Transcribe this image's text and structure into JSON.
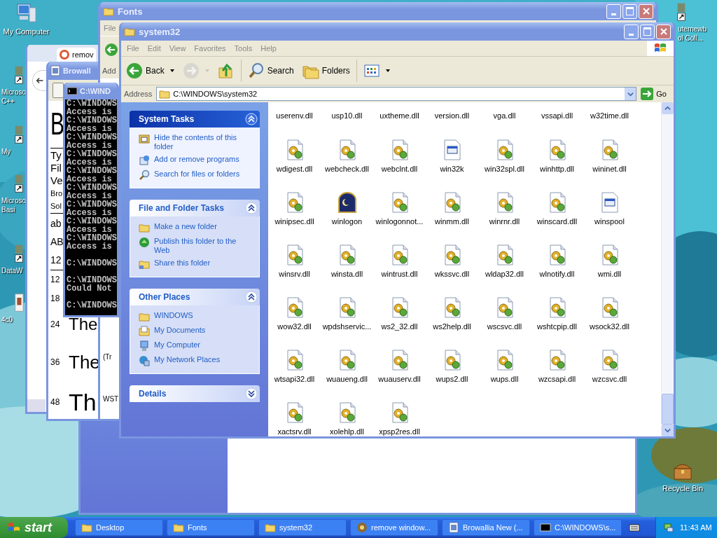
{
  "desktop_icons": [
    {
      "kind": "computer",
      "label_lines": [
        "My Computer"
      ]
    },
    {
      "kind": "shortcut",
      "label_lines": [
        "Microso",
        "C++"
      ]
    },
    {
      "kind": "shortcut",
      "label_lines": [
        "My"
      ]
    },
    {
      "kind": "shortcut",
      "label_lines": [
        "Microso",
        "Basi"
      ]
    },
    {
      "kind": "shortcut",
      "label_lines": [
        "DataW"
      ]
    },
    {
      "kind": "document",
      "label_lines": [
        "4c0"
      ]
    },
    {
      "kind": "shortcut",
      "label_lines": [
        "uternewb",
        "ol Coll..."
      ]
    },
    {
      "kind": "recycle",
      "label_lines": [
        "Recycle Bin"
      ]
    }
  ],
  "browser_window": {
    "tab_title": "remov"
  },
  "font_viewer": {
    "title": "Browall",
    "sample_big": "B",
    "info_lines": [
      "Ty",
      "Fil",
      "Ve",
      "Bro",
      "Sol"
    ],
    "charset_lines": [
      "ab",
      "AB",
      "12"
    ],
    "size_rows": [
      {
        "size": "12"
      },
      {
        "size": "18"
      },
      {
        "size": "24",
        "sample": "The"
      },
      {
        "size": "36",
        "sample": "The"
      },
      {
        "size": "48",
        "sample": "Th"
      }
    ]
  },
  "fonts_window": {
    "title": "Fonts",
    "menu_first": "File",
    "address_label": "Add",
    "content_texts": [
      "(Tr",
      "WST"
    ]
  },
  "console": {
    "title": "C:\\WIND",
    "blocks": [
      [
        "C:\\WINDOWS",
        "Access is",
        "C:\\WINDOWS",
        "Access is",
        "C:\\WINDOWS",
        "Access is",
        "C:\\WINDOWS",
        "Access is",
        "C:\\WINDOWS",
        "Access is",
        "C:\\WINDOWS",
        "Access is",
        "C:\\WINDOWS",
        "Access is",
        "C:\\WINDOWS",
        "Access is",
        "C:\\WINDOWS",
        "Access is"
      ],
      [
        "C:\\WINDOWS"
      ],
      [
        "C:\\WINDOWS",
        "Could Not"
      ],
      [
        "C:\\WINDOWS"
      ]
    ]
  },
  "explorer": {
    "title": "system32",
    "menu": [
      "File",
      "Edit",
      "View",
      "Favorites",
      "Tools",
      "Help"
    ],
    "toolbar": [
      {
        "kind": "back",
        "label": "Back",
        "disabled": false
      },
      {
        "kind": "forward",
        "disabled": true
      },
      {
        "kind": "up",
        "disabled": false
      },
      {
        "kind": "search",
        "label": "Search",
        "disabled": false
      },
      {
        "kind": "folders",
        "label": "Folders",
        "disabled": false
      },
      {
        "kind": "views",
        "disabled": false
      }
    ],
    "address_label": "Address",
    "address": "C:\\WINDOWS\\system32",
    "go": "Go",
    "panels": [
      {
        "title": "System Tasks",
        "special": true,
        "expanded": true,
        "links": [
          {
            "kind": "hide",
            "label": "Hide the contents of this folder"
          },
          {
            "kind": "programs",
            "label": "Add or remove programs"
          },
          {
            "kind": "search",
            "label": "Search for files or folders"
          }
        ]
      },
      {
        "title": "File and Folder Tasks",
        "special": false,
        "expanded": true,
        "links": [
          {
            "kind": "new-folder",
            "label": "Make a new folder"
          },
          {
            "kind": "publish",
            "label": "Publish this folder to the Web"
          },
          {
            "kind": "share",
            "label": "Share this folder"
          }
        ]
      },
      {
        "title": "Other Places",
        "special": false,
        "expanded": true,
        "links": [
          {
            "kind": "folder",
            "label": "WINDOWS"
          },
          {
            "kind": "documents",
            "label": "My Documents"
          },
          {
            "kind": "computer",
            "label": "My Computer"
          },
          {
            "kind": "network",
            "label": "My Network Places"
          }
        ]
      },
      {
        "title": "Details",
        "special": false,
        "expanded": false
      }
    ],
    "cut_row": [
      "userenv.dll",
      "usp10.dll",
      "uxtheme.dll",
      "version.dll",
      "vga.dll",
      "vssapi.dll",
      "w32time.dll"
    ],
    "files": [
      {
        "name": "wdigest.dll",
        "kind": "dll"
      },
      {
        "name": "webcheck.dll",
        "kind": "dll"
      },
      {
        "name": "webclnt.dll",
        "kind": "dll"
      },
      {
        "name": "win32k",
        "kind": "system"
      },
      {
        "name": "win32spl.dll",
        "kind": "dll"
      },
      {
        "name": "winhttp.dll",
        "kind": "dll"
      },
      {
        "name": "wininet.dll",
        "kind": "dll"
      },
      {
        "name": "winipsec.dll",
        "kind": "dll"
      },
      {
        "name": "winlogon",
        "kind": "logon"
      },
      {
        "name": "winlogonnot...",
        "kind": "dll"
      },
      {
        "name": "winmm.dll",
        "kind": "dll"
      },
      {
        "name": "winrnr.dll",
        "kind": "dll"
      },
      {
        "name": "winscard.dll",
        "kind": "dll"
      },
      {
        "name": "winspool",
        "kind": "system"
      },
      {
        "name": "winsrv.dll",
        "kind": "dll"
      },
      {
        "name": "winsta.dll",
        "kind": "dll"
      },
      {
        "name": "wintrust.dll",
        "kind": "dll"
      },
      {
        "name": "wkssvc.dll",
        "kind": "dll"
      },
      {
        "name": "wldap32.dll",
        "kind": "dll"
      },
      {
        "name": "wlnotify.dll",
        "kind": "dll"
      },
      {
        "name": "wmi.dll",
        "kind": "dll"
      },
      {
        "name": "wow32.dll",
        "kind": "dll"
      },
      {
        "name": "wpdshservic...",
        "kind": "dll"
      },
      {
        "name": "ws2_32.dll",
        "kind": "dll"
      },
      {
        "name": "ws2help.dll",
        "kind": "dll"
      },
      {
        "name": "wscsvc.dll",
        "kind": "dll"
      },
      {
        "name": "wshtcpip.dll",
        "kind": "dll"
      },
      {
        "name": "wsock32.dll",
        "kind": "dll"
      },
      {
        "name": "wtsapi32.dll",
        "kind": "dll"
      },
      {
        "name": "wuaueng.dll",
        "kind": "dll"
      },
      {
        "name": "wuauserv.dll",
        "kind": "dll"
      },
      {
        "name": "wups2.dll",
        "kind": "dll"
      },
      {
        "name": "wups.dll",
        "kind": "dll"
      },
      {
        "name": "wzcsapi.dll",
        "kind": "dll"
      },
      {
        "name": "wzcsvc.dll",
        "kind": "dll"
      },
      {
        "name": "xactsrv.dll",
        "kind": "dll"
      },
      {
        "name": "xolehlp.dll",
        "kind": "dll"
      },
      {
        "name": "xpsp2res.dll",
        "kind": "dll"
      }
    ]
  },
  "taskbar": {
    "start": "start",
    "tasks": [
      {
        "kind": "folder",
        "label": "Desktop",
        "selected": false
      },
      {
        "kind": "folder",
        "label": "Fonts",
        "selected": false
      },
      {
        "kind": "folder",
        "label": "system32",
        "selected": false
      },
      {
        "kind": "browser",
        "label": "remove window...",
        "selected": false
      },
      {
        "kind": "font",
        "label": "Browallia New (...",
        "selected": false
      },
      {
        "kind": "console",
        "label": "C:\\WINDOWS\\s...",
        "selected": false
      }
    ],
    "clock": "11:43 AM"
  }
}
